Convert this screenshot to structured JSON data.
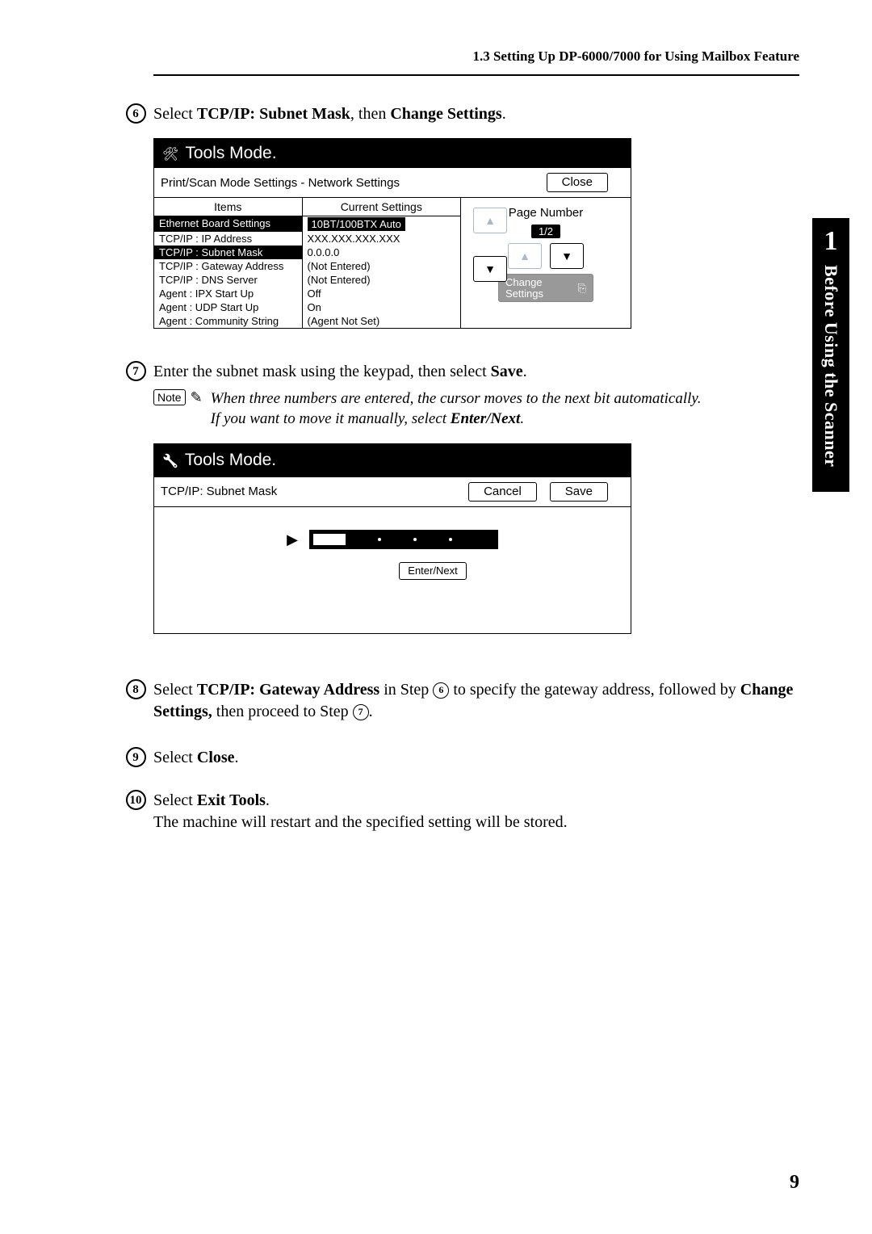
{
  "page": {
    "header": "1.3  Setting Up DP-6000/7000 for Using Mailbox Feature",
    "page_number": "9",
    "chapter_num": "1",
    "chapter_title": "Before Using the Scanner"
  },
  "steps": {
    "s6": {
      "num": "6",
      "text_pre": "Select ",
      "bold1": "TCP/IP: Subnet Mask",
      "mid": ", then ",
      "bold2": "Change Settings",
      "post": "."
    },
    "s7": {
      "num": "7",
      "text_pre": "Enter the subnet mask using the keypad, then select ",
      "bold1": "Save",
      "post": "."
    },
    "s7note": {
      "label": "Note",
      "line1_a": "When three numbers are entered, the cursor moves to the next bit automatically.",
      "line2_a": "If you want to move it manually, select ",
      "line2_b": "Enter/Next",
      "line2_c": "."
    },
    "s8": {
      "num": "8",
      "pre": "Select ",
      "b1": "TCP/IP: Gateway Address",
      "mid1": " in Step ",
      "ref1": "6",
      "mid2": " to specify the gateway address, followed by ",
      "b2": "Change Settings,",
      "mid3": " then proceed to Step ",
      "ref2": "7",
      "post": "."
    },
    "s9": {
      "num": "9",
      "pre": "Select ",
      "b1": "Close",
      "post": "."
    },
    "s10": {
      "num": "10",
      "pre": "Select ",
      "b1": "Exit Tools",
      "post1": ".",
      "line2": "The machine will restart and the specified setting will be stored."
    }
  },
  "screen1": {
    "title": "Tools Mode.",
    "subtitle": "Print/Scan Mode Settings - Network Settings",
    "close": "Close",
    "col_items": "Items",
    "col_current": "Current Settings",
    "rows": [
      {
        "item": "Ethernet Board Settings",
        "value": "10BT/100BTX Auto",
        "hi": true,
        "boxed": true
      },
      {
        "item": "TCP/IP : IP Address",
        "value": "XXX.XXX.XXX.XXX"
      },
      {
        "item": "TCP/IP : Subnet Mask",
        "value": "0.0.0.0",
        "hi": true
      },
      {
        "item": "TCP/IP : Gateway Address",
        "value": "(Not Entered)"
      },
      {
        "item": "TCP/IP : DNS Server",
        "value": "(Not Entered)"
      },
      {
        "item": "Agent : IPX Start Up",
        "value": "Off"
      },
      {
        "item": "Agent : UDP Start Up",
        "value": "On"
      },
      {
        "item": "Agent : Community String",
        "value": "(Agent Not Set)"
      }
    ],
    "page_label": "Page Number",
    "page_ind": "1/2",
    "change_line1": "Change",
    "change_line2": "Settings",
    "up": "▲",
    "down": "▼"
  },
  "screen2": {
    "title": "Tools Mode.",
    "subtitle": "TCP/IP: Subnet Mask",
    "cancel": "Cancel",
    "save": "Save",
    "enter_next": "Enter/Next",
    "cursor": "▶"
  }
}
